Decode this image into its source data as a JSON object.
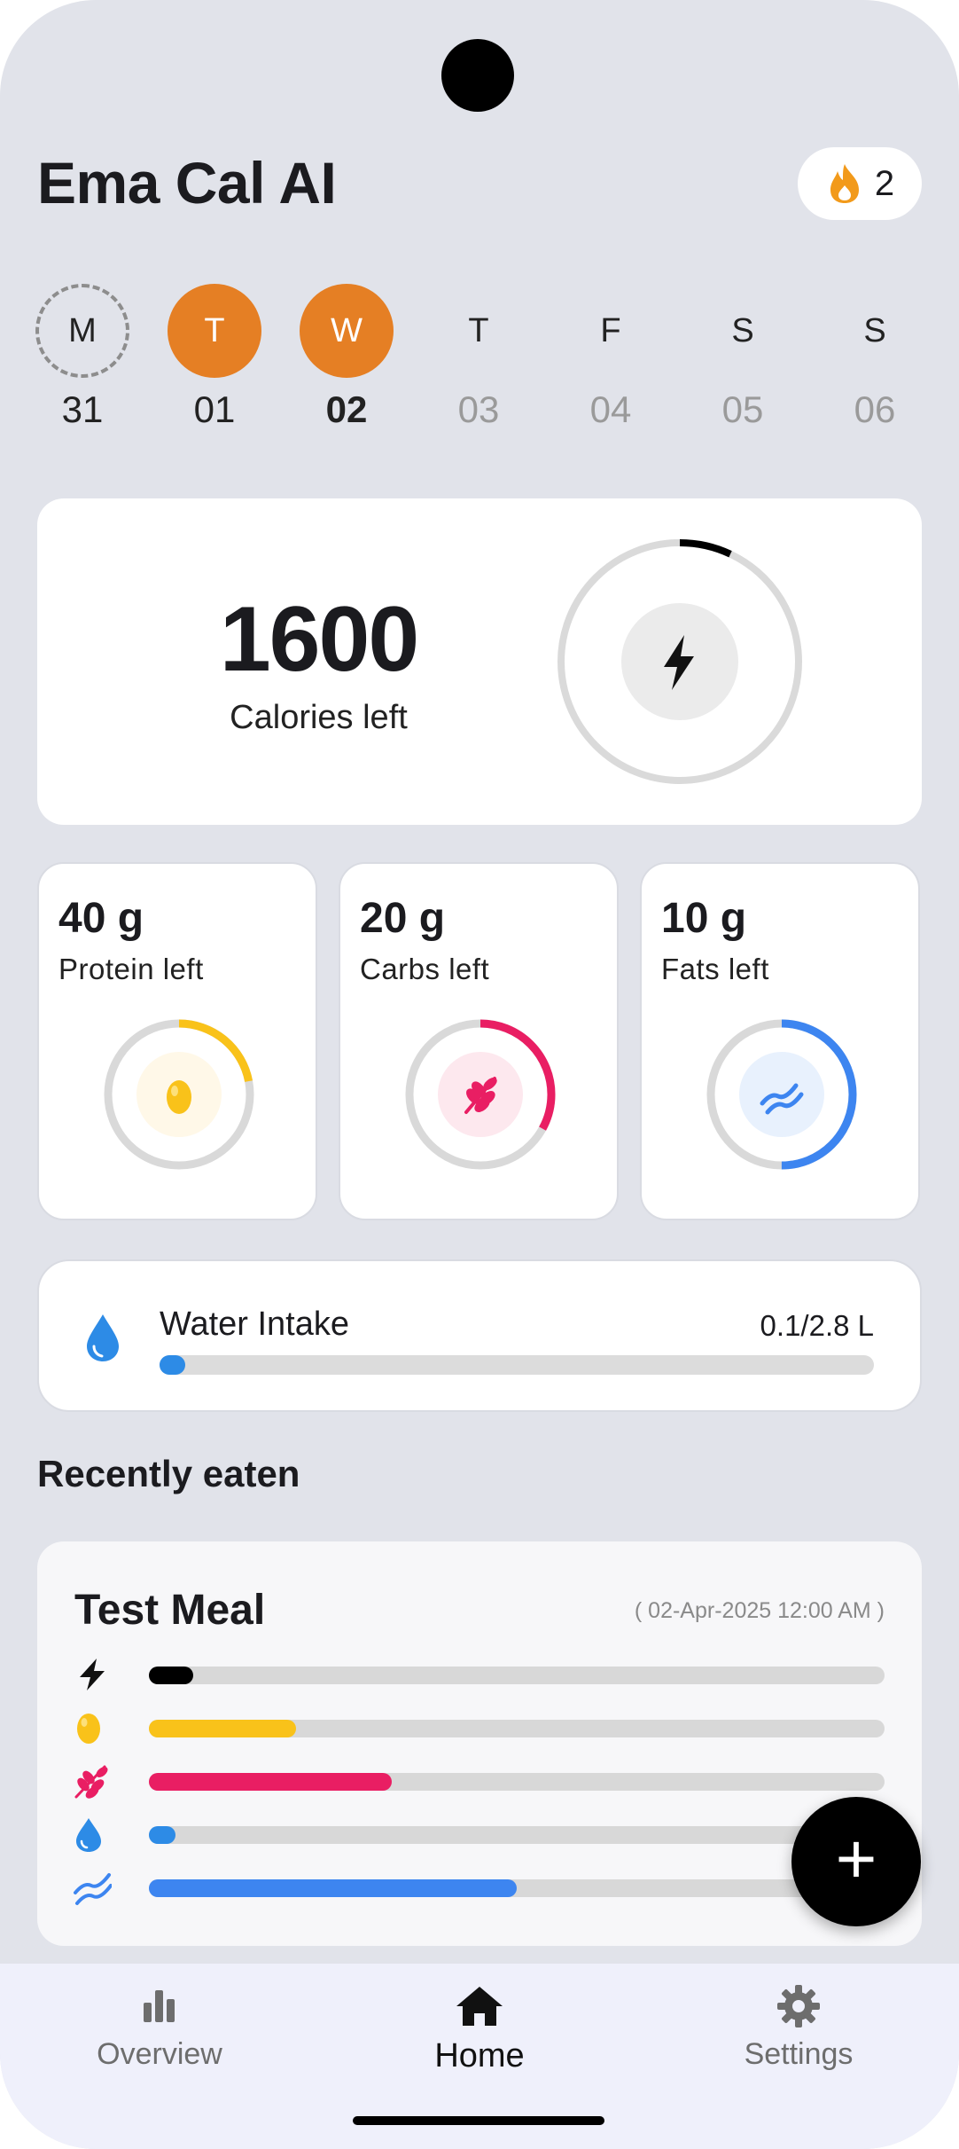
{
  "app": {
    "title": "Ema Cal AI",
    "streak_count": "2"
  },
  "week": [
    {
      "letter": "M",
      "date": "31",
      "state": "dashed"
    },
    {
      "letter": "T",
      "date": "01",
      "state": "active"
    },
    {
      "letter": "W",
      "date": "02",
      "state": "active-today"
    },
    {
      "letter": "T",
      "date": "03",
      "state": "future"
    },
    {
      "letter": "F",
      "date": "04",
      "state": "future"
    },
    {
      "letter": "S",
      "date": "05",
      "state": "future"
    },
    {
      "letter": "S",
      "date": "06",
      "state": "future"
    }
  ],
  "calories": {
    "value": "1600",
    "label": "Calories left",
    "progress": 0.07,
    "color": "#000000",
    "icon": "lightning-icon"
  },
  "macros": [
    {
      "amount": "40 g",
      "label": "Protein left",
      "progress": 0.22,
      "color": "#f9c21a",
      "bg": "#fff8e8",
      "icon": "egg-icon"
    },
    {
      "amount": "20 g",
      "label": "Carbs left",
      "progress": 0.33,
      "color": "#e91e63",
      "bg": "#fde8ee",
      "icon": "wheat-icon"
    },
    {
      "amount": "10 g",
      "label": "Fats left",
      "progress": 0.5,
      "color": "#3d85f0",
      "bg": "#e8f1fd",
      "icon": "bacon-icon"
    }
  ],
  "water": {
    "label": "Water Intake",
    "value": "0.1/2.8 L",
    "progress": 0.036,
    "color": "#2d8be6",
    "icon": "water-drop-icon"
  },
  "recent": {
    "heading": "Recently eaten",
    "meal": {
      "name": "Test Meal",
      "datetime": "( 02-Apr-2025 12:00 AM )",
      "rows": [
        {
          "icon": "lightning-icon",
          "progress": 0.06,
          "color": "#000000"
        },
        {
          "icon": "egg-icon",
          "progress": 0.2,
          "color": "#f9c21a"
        },
        {
          "icon": "wheat-icon",
          "progress": 0.33,
          "color": "#e91e63"
        },
        {
          "icon": "water-drop-icon",
          "progress": 0.036,
          "color": "#2d8be6"
        },
        {
          "icon": "bacon-icon",
          "progress": 0.5,
          "color": "#3d85f0"
        }
      ]
    }
  },
  "nav": {
    "overview": "Overview",
    "home": "Home",
    "settings": "Settings"
  }
}
